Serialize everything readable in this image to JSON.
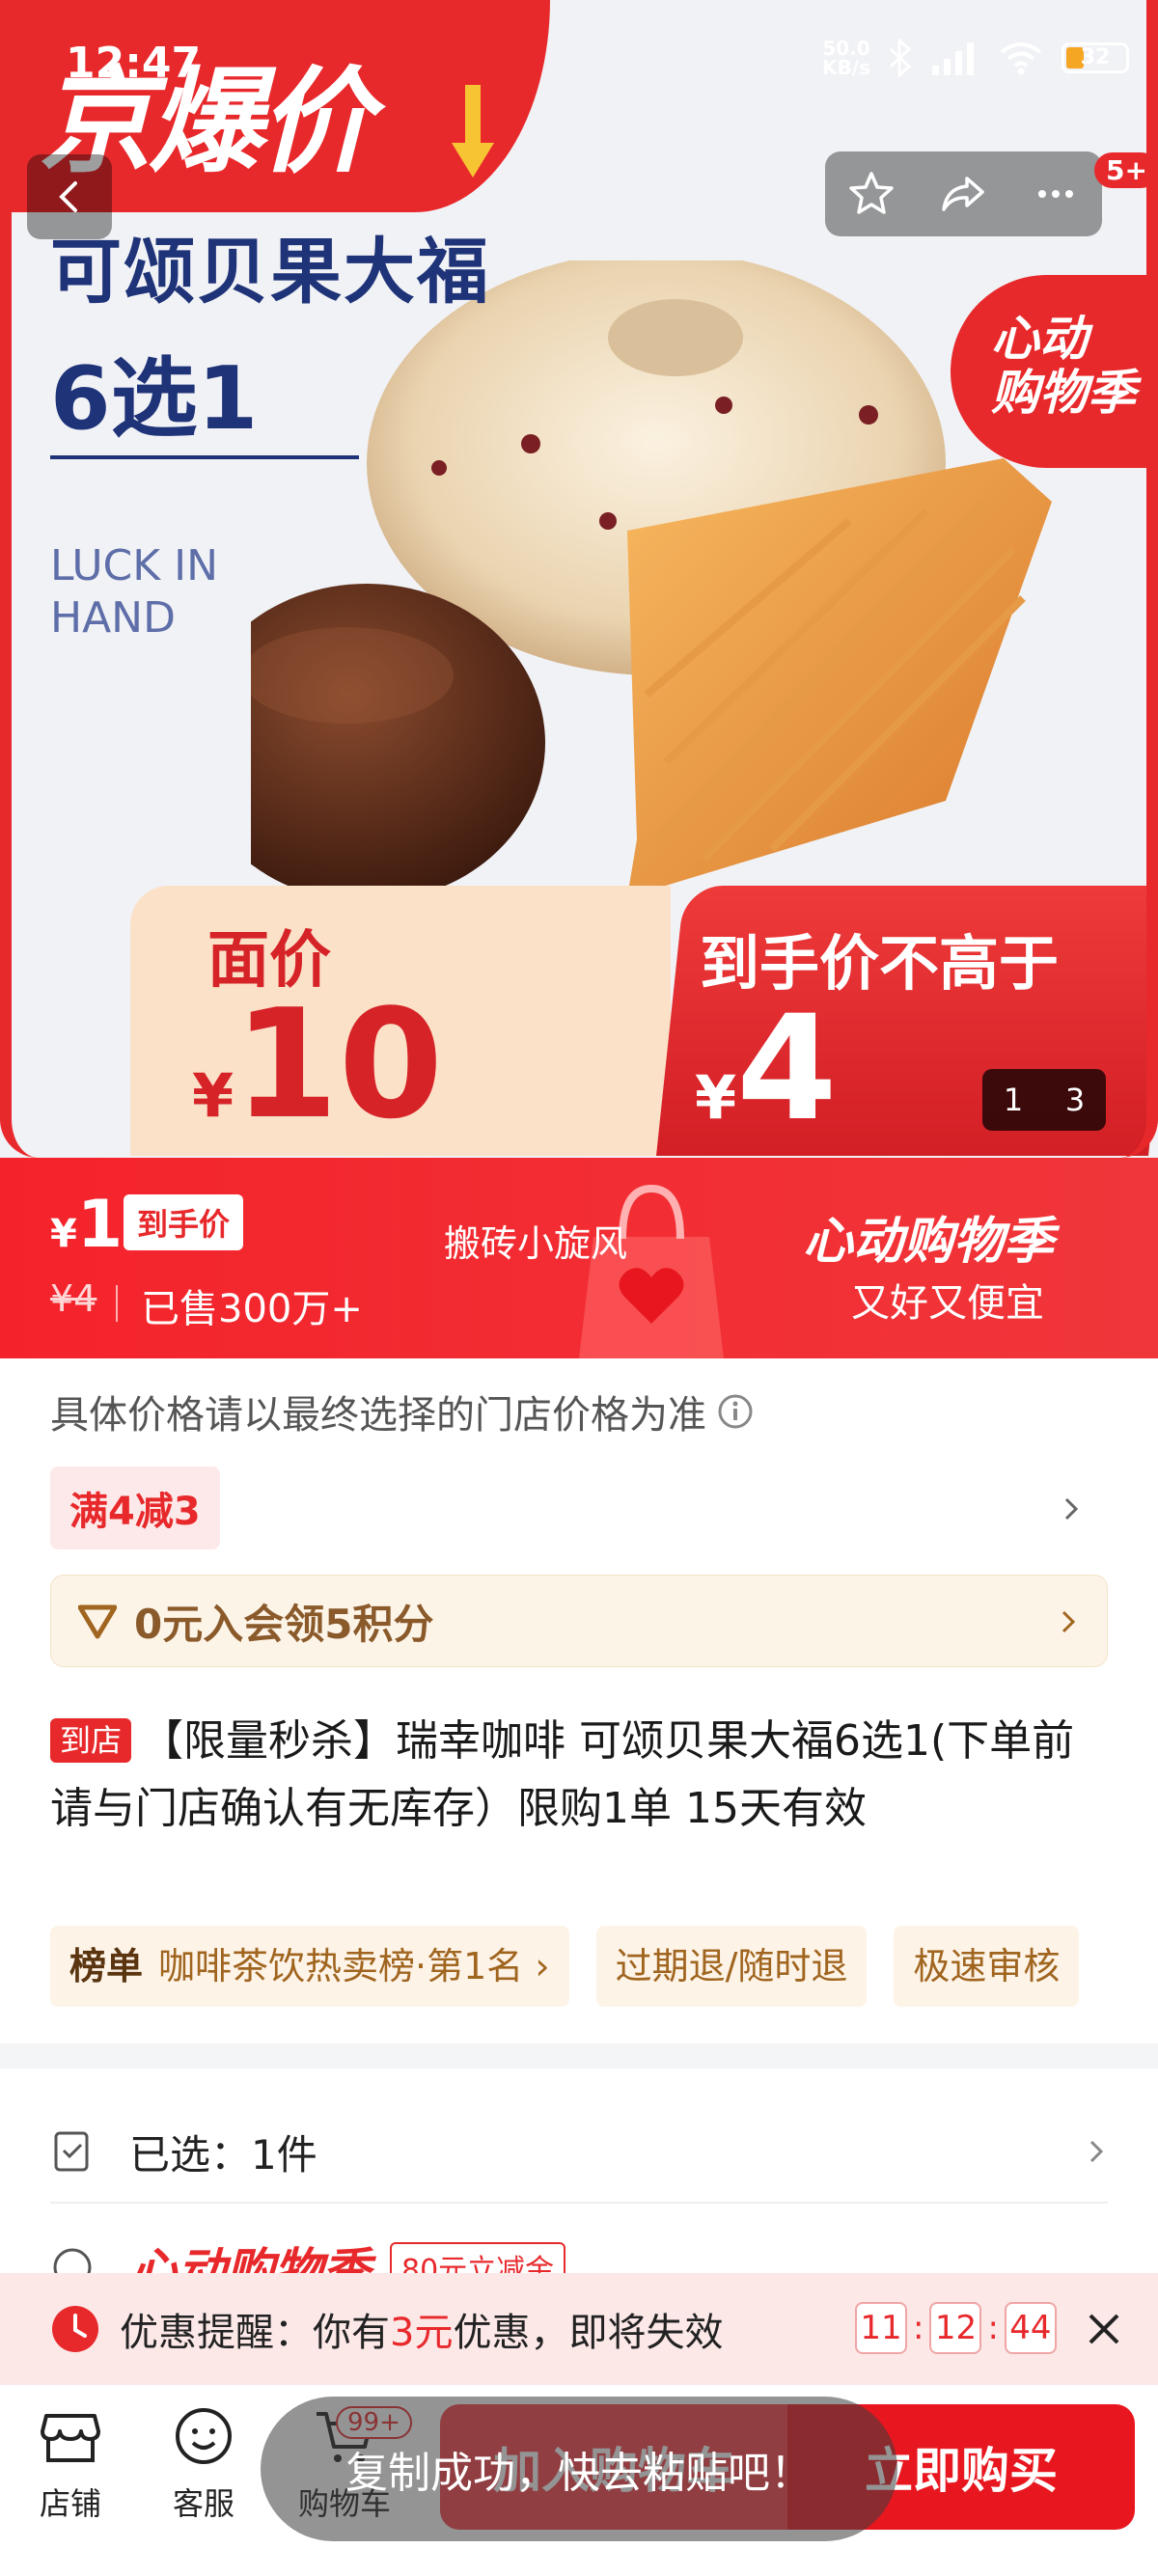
{
  "status_bar": {
    "time": "12:47",
    "net_speed": "50.0",
    "net_unit": "KB/s",
    "battery": "32"
  },
  "hero": {
    "banner": "京爆价",
    "product_title": "可颂贝果大福",
    "product_subtitle": "6选1",
    "tagline_en": [
      "LUCK IN",
      "HAND"
    ],
    "season": [
      "心动",
      "购物季"
    ],
    "face_value_label": "面价",
    "face_value_currency": "¥",
    "face_value": "10",
    "hand_price_label": "到手价不高于",
    "hand_price_currency": "¥",
    "hand_price": "4",
    "pager_current": "1",
    "pager_total": "3",
    "badge_count": "5+"
  },
  "price_bar": {
    "currency": "¥",
    "price": "1",
    "price_tag": "到手价",
    "original_price": "¥4",
    "sold": "已售300万+",
    "note": "搬砖小旋风",
    "season": "心动购物季",
    "slogan": "又好又便宜"
  },
  "details": {
    "disclaimer": "具体价格请以最终选择的门店价格为准",
    "coupon": "满4减3",
    "member": "0元入会领5积分",
    "store_tag": "到店",
    "title": "【限量秒杀】瑞幸咖啡 可颂贝果大福6选1(下单前请与门店确认有无库存）限购1单 15天有效",
    "rank_label": "榜单",
    "rank_text": "咖啡茶饮热卖榜·第1名",
    "chips": [
      "过期退/随时退",
      "极速审核"
    ],
    "selected": "已选：1件",
    "season_logo": "心动购物季",
    "season_badge": "80元立减金"
  },
  "reminder": {
    "text_prefix": "优惠提醒：你有",
    "amount": "3元",
    "text_suffix": "优惠，即将失效",
    "hh": "11",
    "mm": "12",
    "ss": "44"
  },
  "bottom_bar": {
    "store": "店铺",
    "service": "客服",
    "cart": "购物车",
    "cart_badge": "99+",
    "add_cart": "加入购物车",
    "buy_now": "立即购买",
    "toast": "复制成功，快去粘贴吧！"
  },
  "colors": {
    "accent": "#e8292c",
    "navy": "#1f3378"
  }
}
